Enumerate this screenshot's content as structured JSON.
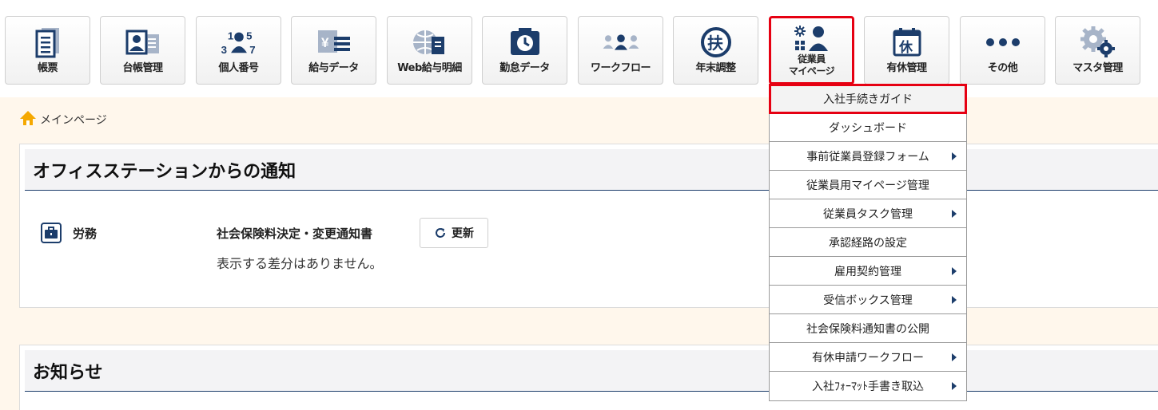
{
  "nav": [
    {
      "label": "帳票",
      "icon": "report-icon"
    },
    {
      "label": "台帳管理",
      "icon": "ledger-icon"
    },
    {
      "label": "個人番号",
      "icon": "personal-number-icon"
    },
    {
      "label": "給与データ",
      "icon": "salary-data-icon"
    },
    {
      "label": "Web給与明細",
      "icon": "web-payslip-icon"
    },
    {
      "label": "勤怠データ",
      "icon": "attendance-icon"
    },
    {
      "label": "ワークフロー",
      "icon": "workflow-icon"
    },
    {
      "label": "年末調整",
      "icon": "year-end-icon"
    },
    {
      "label": "従業員",
      "label2": "マイページ",
      "icon": "employee-mypage-icon"
    },
    {
      "label": "有休管理",
      "icon": "paid-leave-icon"
    },
    {
      "label": "その他",
      "icon": "more-icon"
    },
    {
      "label": "マスタ管理",
      "icon": "master-settings-icon"
    }
  ],
  "breadcrumb": {
    "home": "メインページ"
  },
  "notice_panel": {
    "title": "オフィスステーションからの通知",
    "category": "労務",
    "notice_title": "社会保険料決定・変更通知書",
    "refresh_label": "更新",
    "message": "表示する差分はありません。"
  },
  "news_panel": {
    "title": "お知らせ"
  },
  "dropdown": [
    {
      "label": "入社手続きガイド",
      "submenu": false
    },
    {
      "label": "ダッシュボード",
      "submenu": false
    },
    {
      "label": "事前従業員登録フォーム",
      "submenu": true
    },
    {
      "label": "従業員用マイページ管理",
      "submenu": false
    },
    {
      "label": "従業員タスク管理",
      "submenu": true
    },
    {
      "label": "承認経路の設定",
      "submenu": false
    },
    {
      "label": "雇用契約管理",
      "submenu": true
    },
    {
      "label": "受信ボックス管理",
      "submenu": true
    },
    {
      "label": "社会保険料通知書の公開",
      "submenu": false
    },
    {
      "label": "有休申請ワークフロー",
      "submenu": true
    },
    {
      "label": "入社ﾌｫｰﾏｯﾄ手書き取込",
      "submenu": true
    }
  ],
  "colors": {
    "navy": "#1c3d6b",
    "highlight": "#e60012",
    "accent_orange": "#f5a800"
  }
}
